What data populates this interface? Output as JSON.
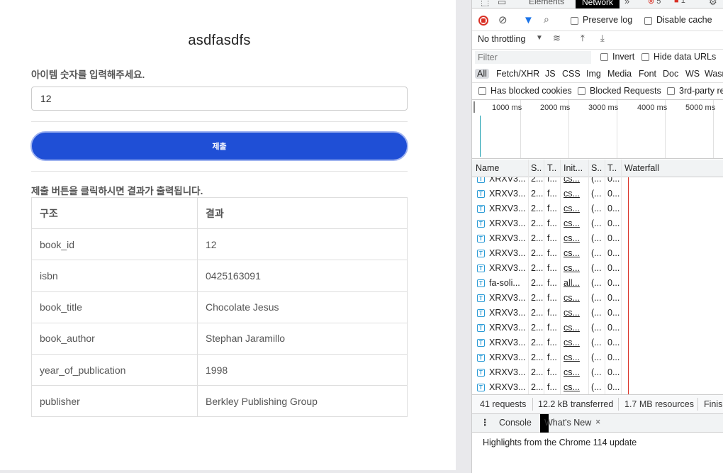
{
  "page": {
    "title": "asdfasdfs",
    "input_label": "아이템 숫자를 입력해주세요.",
    "input_value": "12",
    "submit_label": "제출",
    "result_note": "제출 버튼을 클릭하시면 결과가 출력됩니다.",
    "table": {
      "headers": [
        "구조",
        "결과"
      ],
      "rows": [
        [
          "book_id",
          "12"
        ],
        [
          "isbn",
          "0425163091"
        ],
        [
          "book_title",
          "Chocolate Jesus"
        ],
        [
          "book_author",
          "Stephan Jaramillo"
        ],
        [
          "year_of_publication",
          "1998"
        ],
        [
          "publisher",
          "Berkley Publishing Group"
        ]
      ]
    }
  },
  "devtools": {
    "tabs": [
      "Elements",
      "Network"
    ],
    "active_tab": "Network",
    "error_count": "5",
    "warning_count": "1",
    "preserve_log": "Preserve log",
    "disable_cache": "Disable cache",
    "throttling": "No throttling",
    "filter_placeholder": "Filter",
    "invert": "Invert",
    "hide_data_urls": "Hide data URLs",
    "types": [
      "All",
      "Fetch/XHR",
      "JS",
      "CSS",
      "Img",
      "Media",
      "Font",
      "Doc",
      "WS",
      "Wasm"
    ],
    "blocked_cookies": "Has blocked cookies",
    "blocked_requests": "Blocked Requests",
    "third_party": "3rd-party re",
    "timeline_ticks": [
      "1000 ms",
      "2000 ms",
      "3000 ms",
      "4000 ms",
      "5000 ms"
    ],
    "columns": [
      "Name",
      "S..",
      "T..",
      "Init...",
      "S..",
      "T..",
      "Waterfall"
    ],
    "requests": [
      {
        "name": "XRXV3...",
        "status": "2...",
        "type": "f...",
        "initiator": "cs...",
        "size": "(...",
        "time": "0..."
      },
      {
        "name": "XRXV3...",
        "status": "2...",
        "type": "f...",
        "initiator": "cs...",
        "size": "(...",
        "time": "0..."
      },
      {
        "name": "XRXV3...",
        "status": "2...",
        "type": "f...",
        "initiator": "cs...",
        "size": "(...",
        "time": "0..."
      },
      {
        "name": "XRXV3...",
        "status": "2...",
        "type": "f...",
        "initiator": "cs...",
        "size": "(...",
        "time": "0..."
      },
      {
        "name": "XRXV3...",
        "status": "2...",
        "type": "f...",
        "initiator": "cs...",
        "size": "(...",
        "time": "0..."
      },
      {
        "name": "XRXV3...",
        "status": "2...",
        "type": "f...",
        "initiator": "cs...",
        "size": "(...",
        "time": "0..."
      },
      {
        "name": "XRXV3...",
        "status": "2...",
        "type": "f...",
        "initiator": "cs...",
        "size": "(...",
        "time": "0..."
      },
      {
        "name": "fa-soli...",
        "status": "2...",
        "type": "f...",
        "initiator": "all...",
        "size": "(...",
        "time": "0..."
      },
      {
        "name": "XRXV3...",
        "status": "2...",
        "type": "f...",
        "initiator": "cs...",
        "size": "(...",
        "time": "0..."
      },
      {
        "name": "XRXV3...",
        "status": "2...",
        "type": "f...",
        "initiator": "cs...",
        "size": "(...",
        "time": "0..."
      },
      {
        "name": "XRXV3...",
        "status": "2...",
        "type": "f...",
        "initiator": "cs...",
        "size": "(...",
        "time": "0..."
      },
      {
        "name": "XRXV3...",
        "status": "2...",
        "type": "f...",
        "initiator": "cs...",
        "size": "(...",
        "time": "0..."
      },
      {
        "name": "XRXV3...",
        "status": "2...",
        "type": "f...",
        "initiator": "cs...",
        "size": "(...",
        "time": "0..."
      },
      {
        "name": "XRXV3...",
        "status": "2...",
        "type": "f...",
        "initiator": "cs...",
        "size": "(...",
        "time": "0..."
      },
      {
        "name": "XRXV3...",
        "status": "2...",
        "type": "f...",
        "initiator": "cs...",
        "size": "(...",
        "time": "0..."
      }
    ],
    "summary": {
      "requests": "41 requests",
      "transferred": "12.2 kB transferred",
      "resources": "1.7 MB resources",
      "finish": "Finis"
    },
    "drawer_tabs": [
      "Console",
      "What's New"
    ],
    "drawer_active": "What's New",
    "drawer_text": "Highlights from the Chrome 114 update"
  }
}
